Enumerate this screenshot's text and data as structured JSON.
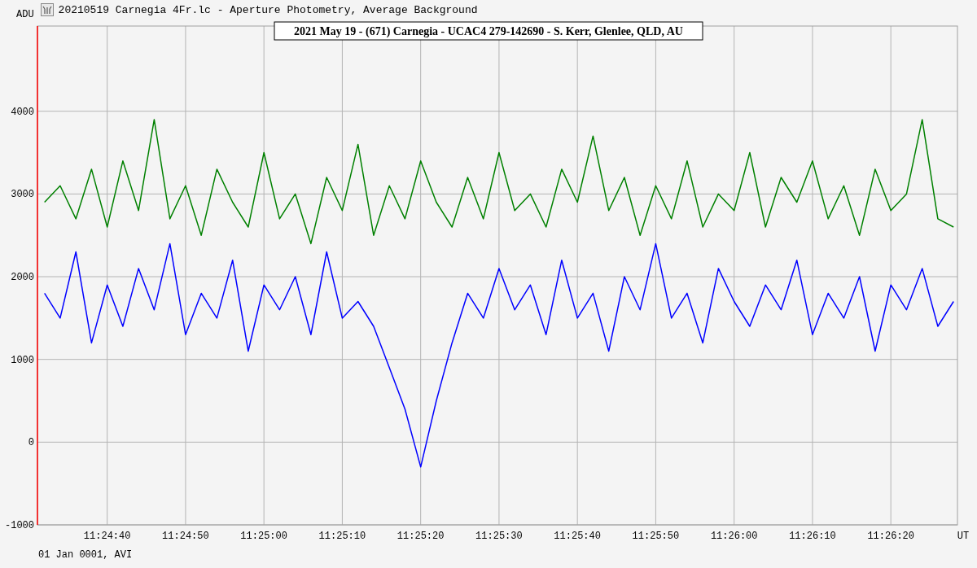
{
  "window": {
    "title": "20210519 Carnegia 4Fr.lc - Aperture Photometry, Average Background"
  },
  "chart": {
    "chart_data": {
      "type": "line",
      "title": "2021 May 19 - (671) Carnegia - UCAC4 279-142690 - S. Kerr, Glenlee, QLD, AU",
      "xlabel": "UT",
      "ylabel": "ADU",
      "x": [
        41072,
        41074,
        41076,
        41078,
        41080,
        41082,
        41084,
        41086,
        41088,
        41090,
        41092,
        41094,
        41096,
        41098,
        41100,
        41102,
        41104,
        41106,
        41108,
        41110,
        41112,
        41114,
        41116,
        41118,
        41120,
        41122,
        41124,
        41126,
        41128,
        41130,
        41132,
        41134,
        41136,
        41138,
        41140,
        41142,
        41144,
        41146,
        41148,
        41150,
        41152,
        41154,
        41156,
        41158,
        41160,
        41162,
        41164,
        41166,
        41168,
        41170,
        41172,
        41174,
        41176,
        41178,
        41180,
        41182,
        41184,
        41186,
        41188
      ],
      "series": [
        {
          "color": "#008000",
          "values": [
            2900,
            3100,
            2700,
            3300,
            2600,
            3400,
            2800,
            3900,
            2700,
            3100,
            2500,
            3300,
            2900,
            2600,
            3500,
            2700,
            3000,
            2400,
            3200,
            2800,
            3600,
            2500,
            3100,
            2700,
            3400,
            2900,
            2600,
            3200,
            2700,
            3500,
            2800,
            3000,
            2600,
            3300,
            2900,
            3700,
            2800,
            3200,
            2500,
            3100,
            2700,
            3400,
            2600,
            3000,
            2800,
            3500,
            2600,
            3200,
            2900,
            3400,
            2700,
            3100,
            2500,
            3300,
            2800,
            3000,
            3900,
            2700,
            2600
          ]
        },
        {
          "color": "#0000ff",
          "values": [
            1800,
            1500,
            2300,
            1200,
            1900,
            1400,
            2100,
            1600,
            2400,
            1300,
            1800,
            1500,
            2200,
            1100,
            1900,
            1600,
            2000,
            1300,
            2300,
            1500,
            1700,
            1400,
            900,
            400,
            -300,
            500,
            1200,
            1800,
            1500,
            2100,
            1600,
            1900,
            1300,
            2200,
            1500,
            1800,
            1100,
            2000,
            1600,
            2400,
            1500,
            1800,
            1200,
            2100,
            1700,
            1400,
            1900,
            1600,
            2200,
            1300,
            1800,
            1500,
            2000,
            1100,
            1900,
            1600,
            2100,
            1400,
            1700
          ]
        }
      ],
      "xlim": [
        41071.1,
        41188.5
      ],
      "ylim": [
        -1000,
        5030
      ],
      "xticks": [
        {
          "value": 41080,
          "label": "11:24:40"
        },
        {
          "value": 41090,
          "label": "11:24:50"
        },
        {
          "value": 41100,
          "label": "11:25:00"
        },
        {
          "value": 41110,
          "label": "11:25:10"
        },
        {
          "value": 41120,
          "label": "11:25:20"
        },
        {
          "value": 41130,
          "label": "11:25:30"
        },
        {
          "value": 41140,
          "label": "11:25:40"
        },
        {
          "value": 41150,
          "label": "11:25:50"
        },
        {
          "value": 41160,
          "label": "11:26:00"
        },
        {
          "value": 41170,
          "label": "11:26:10"
        },
        {
          "value": 41180,
          "label": "11:26:20"
        }
      ],
      "yticks": [
        -1000,
        0,
        1000,
        2000,
        3000,
        4000
      ],
      "grid": true
    },
    "footer": "01 Jan 0001, AVI"
  }
}
